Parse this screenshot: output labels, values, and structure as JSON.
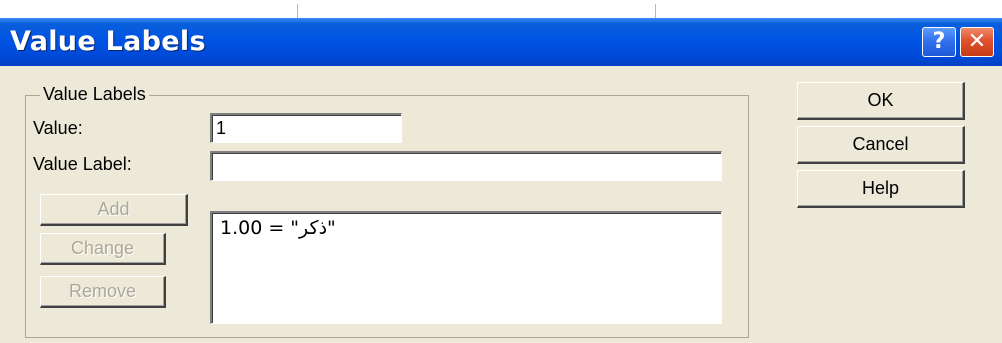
{
  "window": {
    "title": "Value Labels",
    "help_glyph": "?",
    "close_glyph": "✕",
    "icons": {
      "help": "question-mark-icon",
      "close": "close-x-icon"
    }
  },
  "group": {
    "legend": "Value Labels",
    "value_label_text": "Value:",
    "value_input": "1",
    "value_label_label_text": "Value Label:",
    "value_label_input": ""
  },
  "actions": {
    "add": "Add",
    "change": "Change",
    "remove": "Remove"
  },
  "list": {
    "items": [
      "1.00 = \"ذكر\""
    ]
  },
  "side_buttons": {
    "ok": "OK",
    "cancel": "Cancel",
    "help": "Help"
  },
  "colors": {
    "titlebar": "#0054e3",
    "dialog_bg": "#ece9d8",
    "close_button": "#e0522e",
    "help_button": "#2f6fec",
    "disabled_text": "#aca899"
  }
}
